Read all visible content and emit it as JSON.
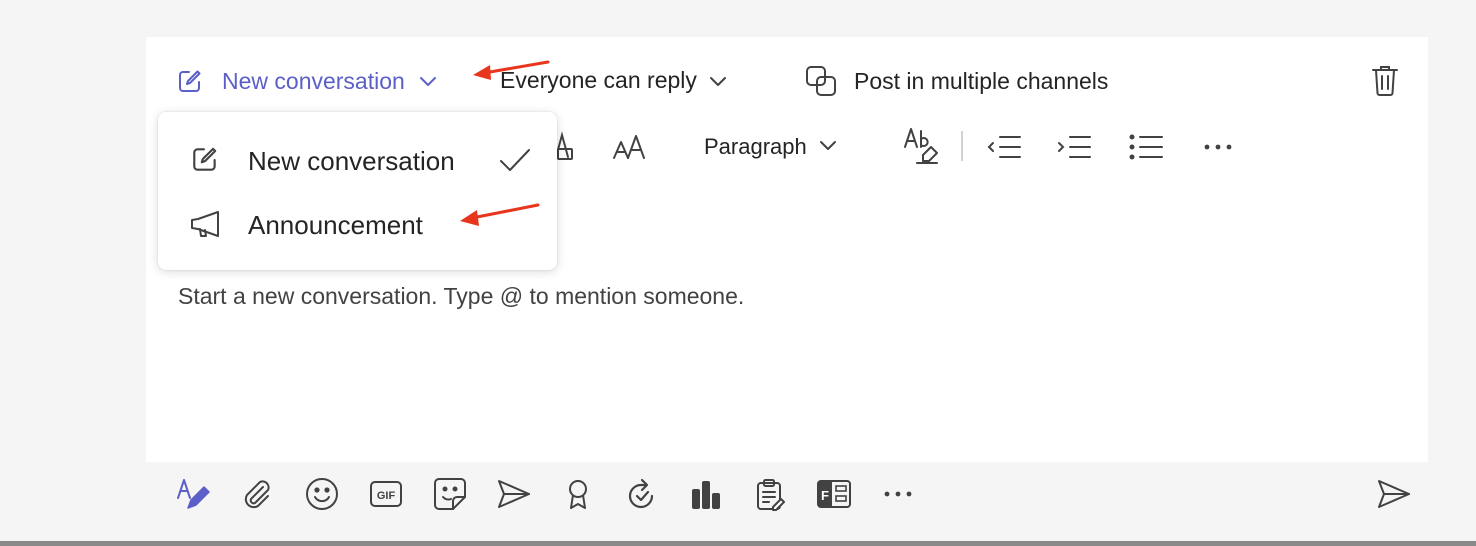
{
  "header": {
    "new_conversation_label": "New conversation",
    "reply_label": "Everyone can reply",
    "multi_channel_label": "Post in multiple channels"
  },
  "format_toolbar": {
    "paragraph_label": "Paragraph"
  },
  "dropdown": {
    "items": [
      {
        "label": "New conversation",
        "icon": "compose-icon",
        "selected": true
      },
      {
        "label": "Announcement",
        "icon": "megaphone-icon",
        "selected": false
      }
    ]
  },
  "editor": {
    "placeholder": "Start a new conversation. Type @ to mention someone."
  },
  "bottom_toolbar": {
    "icons": [
      "format-icon",
      "attach-icon",
      "emoji-icon",
      "gif-icon",
      "sticker-icon",
      "schedule-meeting-icon",
      "praise-icon",
      "loop-icon",
      "approvals-icon",
      "updates-icon",
      "forms-icon",
      "more-icon"
    ]
  },
  "colors": {
    "accent": "#5b5fc7",
    "annotation_arrow": "#e8361d",
    "background": "#f5f5f5"
  }
}
